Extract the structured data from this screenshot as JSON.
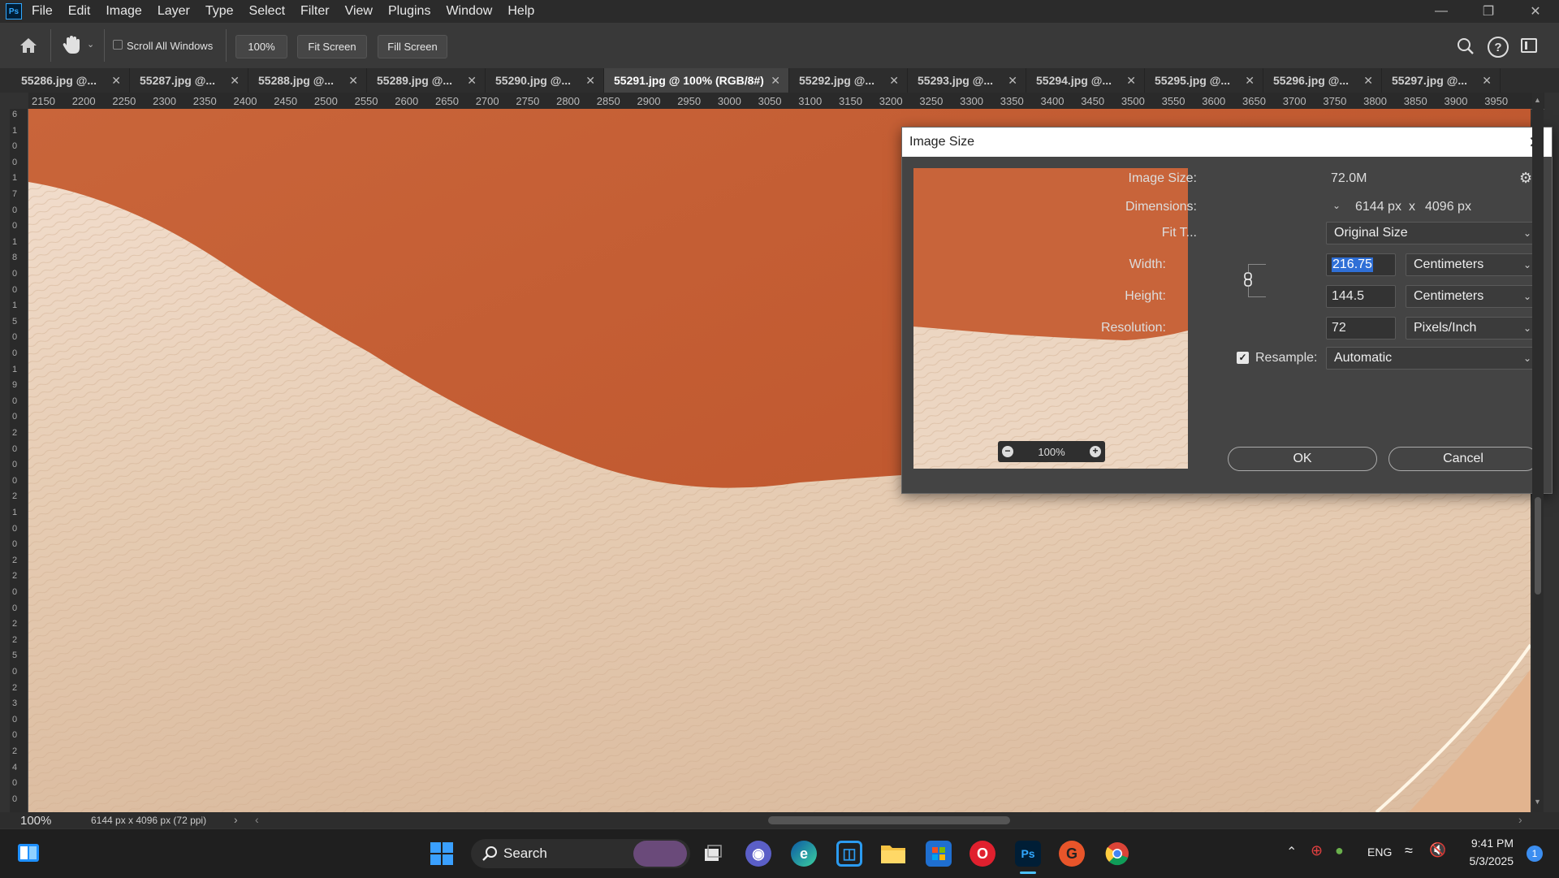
{
  "menubar": {
    "logo": "Ps",
    "items": [
      "File",
      "Edit",
      "Image",
      "Layer",
      "Type",
      "Select",
      "Filter",
      "View",
      "Plugins",
      "Window",
      "Help"
    ]
  },
  "options": {
    "scroll_all_windows": "Scroll All Windows",
    "zoom": "100%",
    "fit_screen": "Fit Screen",
    "fill_screen": "Fill Screen"
  },
  "tabs": [
    {
      "label": "55286.jpg @..."
    },
    {
      "label": "55287.jpg @..."
    },
    {
      "label": "55288.jpg @..."
    },
    {
      "label": "55289.jpg @..."
    },
    {
      "label": "55290.jpg @..."
    },
    {
      "label": "55291.jpg @ 100% (RGB/8#)"
    },
    {
      "label": "55292.jpg @..."
    },
    {
      "label": "55293.jpg @..."
    },
    {
      "label": "55294.jpg @..."
    },
    {
      "label": "55295.jpg @..."
    },
    {
      "label": "55296.jpg @..."
    },
    {
      "label": "55297.jpg @..."
    }
  ],
  "ruler": {
    "h_ticks": [
      "2150",
      "2200",
      "2250",
      "2300",
      "2350",
      "2400",
      "2450",
      "2500",
      "2550",
      "2600",
      "2650",
      "2700",
      "2750",
      "2800",
      "2850",
      "2900",
      "2950",
      "3000",
      "3050",
      "3100",
      "3150",
      "3200",
      "3250",
      "3300",
      "3350",
      "3400",
      "3450",
      "3500",
      "3550",
      "3600",
      "3650",
      "3700",
      "3750",
      "3800",
      "3850",
      "3900",
      "3950"
    ],
    "v_chars": [
      "6",
      "1",
      "0",
      "0",
      "1",
      "7",
      "0",
      "0",
      "1",
      "8",
      "0",
      "0",
      "1",
      "5",
      "0",
      "0",
      "1",
      "9",
      "0",
      "0",
      "2",
      "0",
      "0",
      "0",
      "2",
      "1",
      "0",
      "0",
      "2",
      "2",
      "0",
      "0",
      "2",
      "2",
      "5",
      "0",
      "2",
      "3",
      "0",
      "0",
      "2",
      "4",
      "0",
      "0"
    ]
  },
  "status": {
    "zoom": "100%",
    "doc_info": "6144 px x 4096 px (72 ppi)"
  },
  "dialog": {
    "title": "Image Size",
    "preview_zoom": "100%",
    "image_size_label": "Image Size:",
    "image_size_value": "72.0M",
    "dimensions_label": "Dimensions:",
    "dim_width": "6144 px",
    "dim_times": "x",
    "dim_height": "4096 px",
    "fit_to_label": "Fit T...",
    "fit_to_value": "Original Size",
    "width_label": "Width:",
    "width_value": "216.75",
    "width_unit": "Centimeters",
    "height_label": "Height:",
    "height_value": "144.5",
    "height_unit": "Centimeters",
    "resolution_label": "Resolution:",
    "resolution_value": "72",
    "resolution_unit": "Pixels/Inch",
    "resample_label": "Resample:",
    "resample_value": "Automatic",
    "ok": "OK",
    "cancel": "Cancel"
  },
  "taskbar": {
    "search": "Search",
    "lang": "ENG",
    "time": "9:41 PM",
    "date": "5/3/2025",
    "notification_count": "1",
    "ps_label": "Ps"
  },
  "colors": {
    "backdrop": "#c65f36",
    "fur": "#ead3bd",
    "dialog_bg": "#444444",
    "selected_field": "#2f6fd6",
    "ps_blue": "#31a8ff"
  }
}
